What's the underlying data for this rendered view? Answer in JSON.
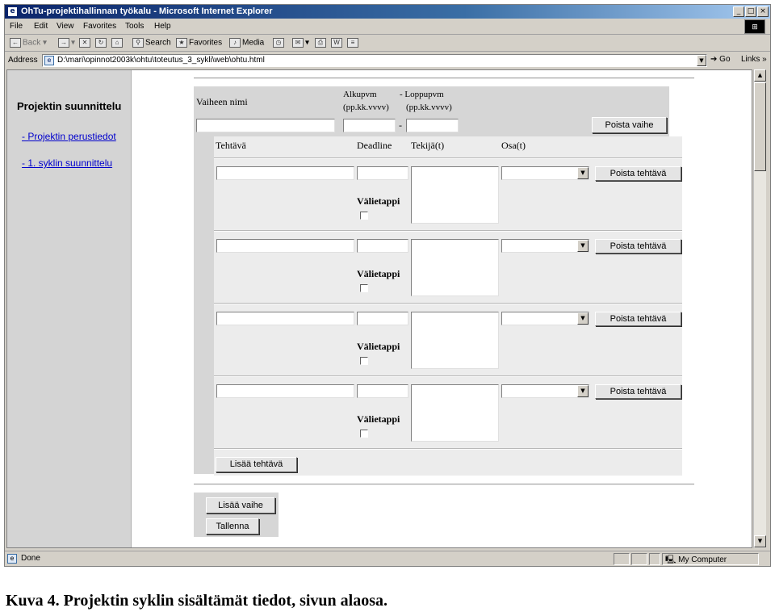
{
  "window": {
    "title": "OhTu-projektihallinnan työkalu - Microsoft Internet Explorer",
    "controls": [
      "_",
      "□",
      "×"
    ]
  },
  "menu": [
    "File",
    "Edit",
    "View",
    "Favorites",
    "Tools",
    "Help"
  ],
  "toolbar": {
    "back": "Back",
    "search": "Search",
    "favorites": "Favorites",
    "media": "Media"
  },
  "address": {
    "label": "Address",
    "url": "D:\\mari\\opinnot2003k\\ohtu\\toteutus_3_sykli\\web\\ohtu.html",
    "go": "Go",
    "links": "Links »"
  },
  "sidebar": {
    "title": "Projektin suunnittelu",
    "links": [
      "- Projektin perustiedot",
      "- 1. syklin suunnittelu"
    ]
  },
  "phase": {
    "name_label": "Vaiheen nimi",
    "start_label": "Alkupvm",
    "start_format": "(pp.kk.vvvv)",
    "end_label": "- Loppupvm",
    "end_format": "(pp.kk.vvvv)",
    "dash": "-",
    "delete_button": "Poista vaihe"
  },
  "task_headers": {
    "task": "Tehtävä",
    "deadline": "Deadline",
    "makers": "Tekijä(t)",
    "parts": "Osa(t)"
  },
  "tasks": [
    {
      "milestone_label": "Välietappi",
      "delete_button": "Poista tehtävä"
    },
    {
      "milestone_label": "Välietappi",
      "delete_button": "Poista tehtävä"
    },
    {
      "milestone_label": "Välietappi",
      "delete_button": "Poista tehtävä"
    },
    {
      "milestone_label": "Välietappi",
      "delete_button": "Poista tehtävä"
    }
  ],
  "add_task_button": "Lisää tehtävä",
  "add_phase_button": "Lisää vaihe",
  "save_button": "Tallenna",
  "status": {
    "text": "Done",
    "zone": "My Computer"
  },
  "caption": "Kuva 4. Projektin syklin sisältämät tiedot, sivun alaosa."
}
